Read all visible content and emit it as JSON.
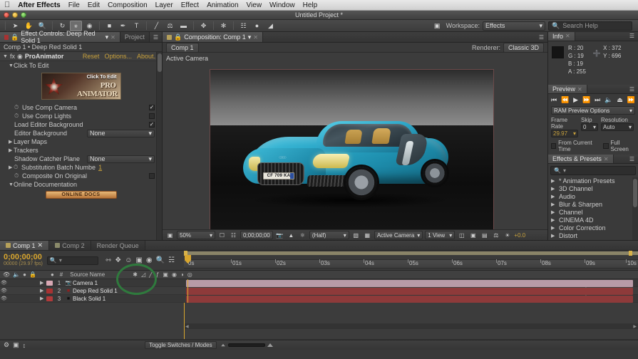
{
  "osmenu": {
    "apple": "apple-logo",
    "app": "After Effects",
    "items": [
      "File",
      "Edit",
      "Composition",
      "Layer",
      "Effect",
      "Animation",
      "View",
      "Window",
      "Help"
    ]
  },
  "window": {
    "title": "Untitled Project *"
  },
  "toolbar": {
    "tools": [
      "selection-arrow",
      "hand",
      "zoom",
      "rotate",
      "puppet-pin",
      "camera-orbit",
      "shape",
      "pen",
      "type",
      "brush",
      "clone-stamp",
      "eraser",
      "roto-brush",
      "pin"
    ],
    "workspace_label": "Workspace:",
    "workspace_value": "Effects",
    "search_placeholder": "Search Help"
  },
  "effect_controls": {
    "tab_label": "Effect Controls: Deep Red Solid 1",
    "project_tab": "Project",
    "breadcrumb": "Comp 1 • Deep Red Solid 1",
    "effect_name": "ProAnimator",
    "links": [
      "Reset",
      "Options...",
      "About..."
    ],
    "group_click_to_edit": "Click To Edit",
    "banner": {
      "top": "Click To Edit",
      "line1": "PRO",
      "line2": "ANIMATOR"
    },
    "properties": [
      {
        "name": "Use Comp Camera",
        "type": "checkbox",
        "checked": true,
        "stopwatch": true
      },
      {
        "name": "Use Comp Lights",
        "type": "checkbox",
        "checked": false,
        "stopwatch": true
      },
      {
        "name": "Load Editor Background",
        "type": "checkbox",
        "checked": true,
        "stopwatch": false
      },
      {
        "name": "Editor Background",
        "type": "dropdown",
        "value": "None"
      }
    ],
    "groups": [
      "Layer Maps",
      "Trackers"
    ],
    "properties2": [
      {
        "name": "Shadow Catcher Plane",
        "type": "dropdown",
        "value": "None"
      },
      {
        "name": "Substitution Batch Numbe",
        "type": "number",
        "value": "1",
        "stopwatch": true
      },
      {
        "name": "Composite On Original",
        "type": "checkbox",
        "checked": false,
        "stopwatch": true
      }
    ],
    "docs_group": "Online Documentation",
    "docs_button": "ONLINE DOCS"
  },
  "composition": {
    "tab_label": "Composition: Comp 1",
    "chip": "Comp 1",
    "renderer_label": "Renderer:",
    "renderer_value": "Classic 3D",
    "active_camera_label": "Active Camera",
    "plate_text": "CF 709 KA",
    "viewer_bar": {
      "zoom": "50%",
      "timecode": "0;00;00;00",
      "resolution": "(Half)",
      "view_camera": "Active Camera",
      "view_layout": "1 View",
      "exposure": "+0.0"
    }
  },
  "info": {
    "tab_label": "Info",
    "R": "R : 20",
    "G": "G : 19",
    "B": "B : 19",
    "A": "A : 255",
    "X": "X : 372",
    "Y": "Y : 696"
  },
  "preview": {
    "tab_label": "Preview",
    "transport": [
      "first-frame",
      "prev-frame",
      "play",
      "next-frame",
      "last-frame",
      "audio",
      "ram-preview",
      "loop"
    ],
    "ram_options": "RAM Preview Options",
    "frame_rate_label": "Frame Rate",
    "frame_rate_value": "29.97",
    "skip_label": "Skip",
    "skip_value": "0",
    "resolution_label": "Resolution",
    "resolution_value": "Auto",
    "from_current_time": "From Current Time",
    "full_screen": "Full Screen"
  },
  "effects_presets": {
    "tab_label": "Effects & Presets",
    "search_placeholder": "",
    "items": [
      "* Animation Presets",
      "3D Channel",
      "Audio",
      "Blur & Sharpen",
      "Channel",
      "CINEMA 4D",
      "Color Correction",
      "Distort"
    ]
  },
  "timeline": {
    "tabs": [
      {
        "label": "Comp 1",
        "active": true,
        "closable": true
      },
      {
        "label": "Comp 2",
        "active": false,
        "closable": false
      },
      {
        "label": "Render Queue",
        "active": false,
        "closable": false
      }
    ],
    "timecode": "0;00;00;00",
    "frame_info": "00000 (29.97 fps)",
    "search_placeholder": "",
    "columns": {
      "source_name": "Source Name",
      "hash": "#"
    },
    "ruler_labels": [
      "0s",
      "01s",
      "02s",
      "03s",
      "04s",
      "05s",
      "06s",
      "07s",
      "08s",
      "09s",
      "10s"
    ],
    "layers": [
      {
        "num": "1",
        "name": "Camera 1",
        "color": "#d8a8b4",
        "bar_color": "#b89aa6",
        "icon": "camera-icon",
        "has_fx": false
      },
      {
        "num": "2",
        "name": "Deep Red Solid 1",
        "color": "#a83232",
        "bar_color": "#8e3a3a",
        "icon": "solid-icon",
        "has_fx": true
      },
      {
        "num": "3",
        "name": "Black Solid 1",
        "color": "#b03a3a",
        "bar_color": "#8e3a3a",
        "icon": "solid-icon",
        "has_fx": true
      }
    ],
    "toggle_switches": "Toggle Switches / Modes"
  },
  "colors": {
    "accent_amber": "#c8a13c",
    "cti": "#d8a62e",
    "annotation_green": "#2f7a3d",
    "car_body": "#2ba8c9"
  }
}
